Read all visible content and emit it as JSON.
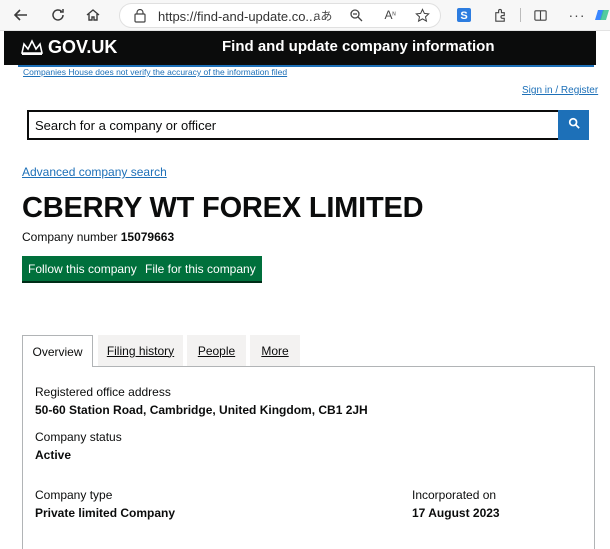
{
  "browser": {
    "url": "https://find-and-update.co...",
    "reader_text": "aあ"
  },
  "header": {
    "logo": "GOV.UK",
    "service_name": "Find and update company information"
  },
  "disclaimer": "Companies House does not verify the accuracy of the information filed",
  "sign_in": "Sign in / Register",
  "search": {
    "placeholder": "Search for a company or officer"
  },
  "advanced_search": "Advanced company search",
  "company": {
    "name": "CBERRY WT FOREX LIMITED",
    "number_label": "Company number",
    "number": "15079663"
  },
  "actions": {
    "follow": "Follow this company",
    "file": "File for this company"
  },
  "tabs": [
    "Overview",
    "Filing history",
    "People",
    "More"
  ],
  "overview": {
    "registered_office_label": "Registered office address",
    "registered_office_value": "50-60 Station Road, Cambridge, United Kingdom, CB1 2JH",
    "status_label": "Company status",
    "status_value": "Active",
    "type_label": "Company type",
    "type_value": "Private limited Company",
    "incorporated_label": "Incorporated on",
    "incorporated_value": "17 August 2023"
  },
  "colors": {
    "govuk_black": "#0b0c0c",
    "link_blue": "#1d70b8",
    "button_green": "#00703c"
  }
}
